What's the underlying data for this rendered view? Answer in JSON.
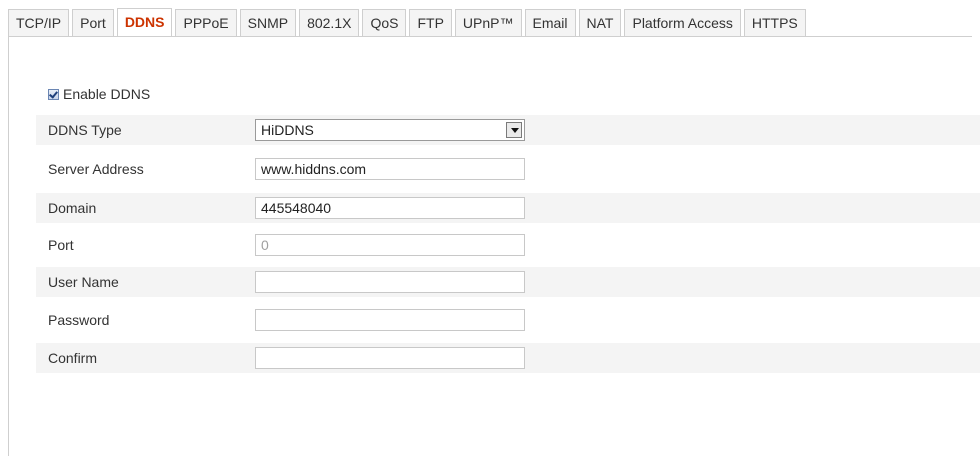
{
  "tabs": [
    {
      "label": "TCP/IP",
      "active": false
    },
    {
      "label": "Port",
      "active": false
    },
    {
      "label": "DDNS",
      "active": true
    },
    {
      "label": "PPPoE",
      "active": false
    },
    {
      "label": "SNMP",
      "active": false
    },
    {
      "label": "802.1X",
      "active": false
    },
    {
      "label": "QoS",
      "active": false
    },
    {
      "label": "FTP",
      "active": false
    },
    {
      "label": "UPnP™",
      "active": false
    },
    {
      "label": "Email",
      "active": false
    },
    {
      "label": "NAT",
      "active": false
    },
    {
      "label": "Platform Access",
      "active": false
    },
    {
      "label": "HTTPS",
      "active": false
    }
  ],
  "form": {
    "enable_label": "Enable DDNS",
    "enable_checked": true,
    "ddns_type_label": "DDNS Type",
    "ddns_type_value": "HiDDNS",
    "server_address_label": "Server Address",
    "server_address_value": "www.hiddns.com",
    "domain_label": "Domain",
    "domain_value": "445548040",
    "port_label": "Port",
    "port_value": "0",
    "user_name_label": "User Name",
    "user_name_value": "",
    "password_label": "Password",
    "password_value": "",
    "confirm_label": "Confirm",
    "confirm_value": ""
  },
  "colors": {
    "active_tab_text": "#cc3300",
    "row_shade": "#f4f4f4",
    "tab_bg": "#f4f4f4"
  }
}
